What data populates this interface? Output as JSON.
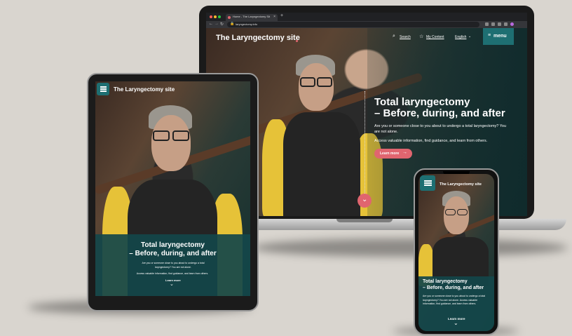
{
  "laptop": {
    "tab_title": "Home - The Laryngectomy Sit",
    "url": "laryngectomy.info",
    "site_title": "The Laryngectomy site",
    "nav": {
      "search": "Search",
      "my_content": "My Content",
      "language": "English",
      "menu": "menu"
    },
    "hero_title_1": "Total laryngectomy",
    "hero_title_2": "– Before, during, and after",
    "hero_text_1": "Are you or someone close to you about to undergo a total laryngectomy? You are not alone.",
    "hero_text_2": "Access valuable information, find guidance, and learn from others.",
    "learn_more": "Learn more"
  },
  "tablet": {
    "site_title": "The Laryngectomy site",
    "hero_title_1": "Total laryngectomy",
    "hero_title_2": "– Before, during, and after",
    "hero_text_1": "Are you or someone close to you about to undergo a total laryngectomy? You are not alone.",
    "hero_text_2": "Access valuable information, find guidance, and learn from others.",
    "learn_more": "Learn more"
  },
  "phone": {
    "site_title": "The Laryngectomy site",
    "hero_title_1": "Total laryngectomy",
    "hero_title_2": "– Before, during, and after",
    "hero_text": "Are you or someone close to you about to undergo a total laryngectomy? You are not alone. Access valuable information, find guidance, and learn from others.",
    "learn_more": "Learn more"
  },
  "colors": {
    "teal": "#1e6f72",
    "accent": "#e0656f",
    "background": "#d9d5cf"
  }
}
